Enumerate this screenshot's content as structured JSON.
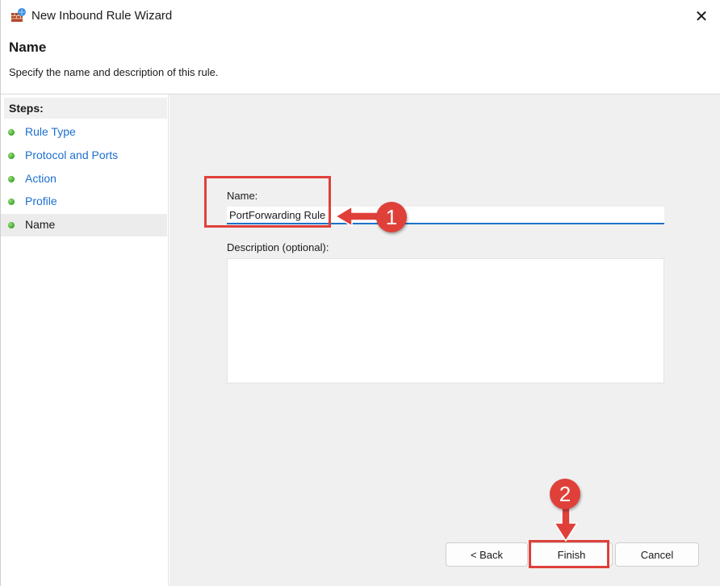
{
  "window": {
    "title": "New Inbound Rule Wizard",
    "close_glyph": "✕",
    "icon": "firewall-icon"
  },
  "header": {
    "title": "Name",
    "subtitle": "Specify the name and description of this rule."
  },
  "sidebar": {
    "steps_title": "Steps:",
    "items": [
      {
        "label": "Rule Type",
        "active": false
      },
      {
        "label": "Protocol and Ports",
        "active": false
      },
      {
        "label": "Action",
        "active": false
      },
      {
        "label": "Profile",
        "active": false
      },
      {
        "label": "Name",
        "active": true
      }
    ]
  },
  "form": {
    "name_label": "Name:",
    "name_value": "PortForwarding Rule",
    "description_label": "Description (optional):",
    "description_value": ""
  },
  "buttons": {
    "back": "< Back",
    "finish": "Finish",
    "cancel": "Cancel"
  },
  "annotations": {
    "badge_1": "1",
    "badge_2": "2",
    "color": "#e0403a"
  },
  "colors": {
    "link": "#1c6fd0",
    "panel_bg": "#f0f0f0",
    "input_focus": "#1a73c9"
  }
}
